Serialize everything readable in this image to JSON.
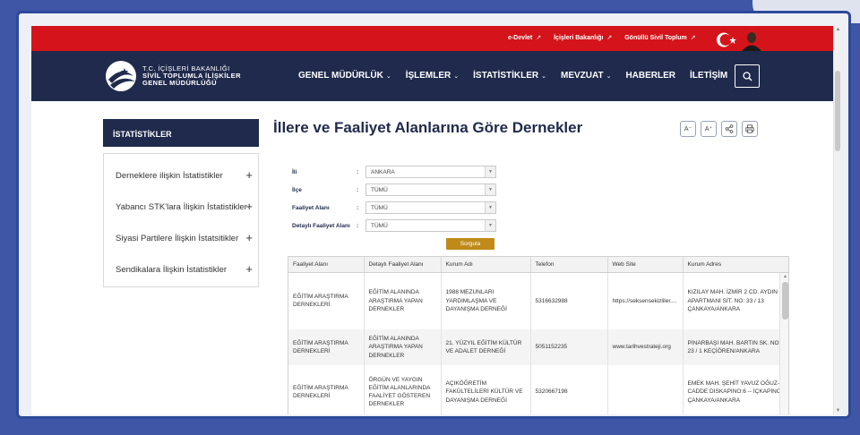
{
  "topbar": {
    "links": [
      {
        "label": "e-Devlet",
        "arrow": "↗"
      },
      {
        "label": "İçişleri Bakanlığı",
        "arrow": "↗"
      },
      {
        "label": "Gönüllü Sivil Toplum",
        "arrow": "↗"
      }
    ],
    "bg_color": "#d4141a"
  },
  "header": {
    "logo": {
      "line1": "T.C. İÇİŞLERİ BAKANLIĞI",
      "line2": "SİVİL TOPLUMLA İLİŞKİLER",
      "line3": "GENEL MÜDÜRLÜĞÜ"
    },
    "nav": [
      {
        "label": "GENEL MÜDÜRLÜK",
        "chevron": "⌄"
      },
      {
        "label": "İŞLEMLER",
        "chevron": "⌄"
      },
      {
        "label": "İSTATİSTİKLER",
        "chevron": "⌄"
      },
      {
        "label": "MEVZUAT",
        "chevron": "⌄"
      },
      {
        "label": "HABERLER",
        "chevron": ""
      },
      {
        "label": "İLETİŞİM",
        "chevron": ""
      }
    ],
    "bg_color": "#1f2a4c"
  },
  "sidebar": {
    "title": "İSTATİSTİKLER",
    "items": [
      {
        "label": "Derneklere ilişkin İstatistikler",
        "icon": "+"
      },
      {
        "label": "Yabancı STK'lara İlişkin İstatistikler",
        "icon": "+"
      },
      {
        "label": "Siyasi Partilere İlişkin İstatsitikler",
        "icon": "+"
      },
      {
        "label": "Sendikalara İlişkin İstatistikler",
        "icon": "+"
      }
    ]
  },
  "main": {
    "title": "İllere ve Faaliyet Alanlarına Göre Dernekler",
    "tools": {
      "font_decrease": "A⁻",
      "font_increase": "A⁺"
    },
    "form": {
      "fields": [
        {
          "label": "İli",
          "value": "ANKARA"
        },
        {
          "label": "İlçe",
          "value": "TÜMÜ"
        },
        {
          "label": "Faaliyet Alanı",
          "value": "TÜMÜ"
        },
        {
          "label": "Detaylı Faaliyet Alanı",
          "value": "TÜMÜ"
        }
      ],
      "submit_label": "Sorgula"
    },
    "table": {
      "headers": [
        "Faaliyet Alanı",
        "Detaylı Faaliyet Alanı",
        "Kurum Adı",
        "Telefon",
        "Web Site",
        "Kurum Adres"
      ],
      "rows": [
        [
          "EĞİTİM ARAŞTIRMA DERNEKLERİ",
          "EĞİTİM ALANINDA ARAŞTIRMA YAPAN DERNEKLER",
          "1988 MEZUNLARI YARDIMLAŞMA VE DAYANIŞMA DERNEĞİ",
          "5316632988",
          "https://seksensekizliler....",
          "KIZILAY MAH. İZMİR 2 CD. AYDIN APARTMANI SİT. NO: 33 / 13 ÇANKAYA/ANKARA"
        ],
        [
          "EĞİTİM ARAŞTIRMA DERNEKLERİ",
          "EĞİTİM ALANINDA ARAŞTIRMA YAPAN DERNEKLER",
          "21. YÜZYIL EĞİTİM KÜLTÜR VE ADALET DERNEĞİ",
          "5051152235",
          "www.tarihvestrateji.org",
          "PINARBAŞI MAH. BARTIN SK. NO: 23 / 1 KEÇİÖREN/ANKARA"
        ],
        [
          "EĞİTİM ARAŞTIRMA DERNEKLERİ",
          "ÖRGÜN VE YAYGIN EĞİTİM ALANLARINDA FAALİYET GÖSTEREN DERNEKLER",
          "AÇIKÖĞRETİM FAKÜLTELİLERİ KÜLTÜR VE DAYANIŞMA DERNEĞİ",
          "5320667198",
          "",
          "EMEK MAH. ŞEHİT YAVUZ OĞUZ-CADDE DISKAPINO:6 -- İÇKAPINO: ÇANKAYA/ANKARA"
        ]
      ]
    },
    "accent_color": "#c08a1a"
  }
}
